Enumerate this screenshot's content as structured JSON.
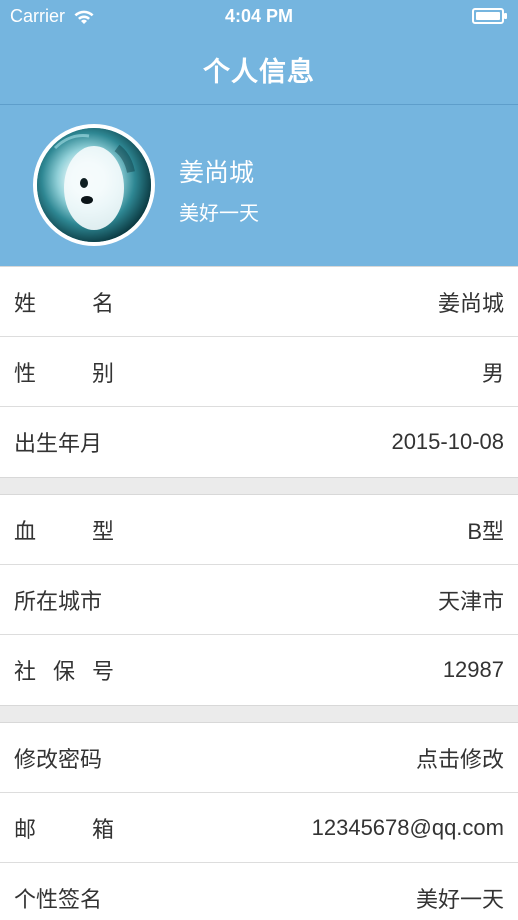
{
  "status_bar": {
    "carrier": "Carrier",
    "time": "4:04 PM"
  },
  "nav": {
    "title": "个人信息"
  },
  "profile": {
    "name": "姜尚城",
    "signature": "美好一天"
  },
  "sections": [
    [
      {
        "label": "姓名",
        "value": "姜尚城"
      },
      {
        "label": "性别",
        "value": "男"
      },
      {
        "label": "出生年月",
        "value": "2015-10-08"
      }
    ],
    [
      {
        "label": "血型",
        "value": "B型"
      },
      {
        "label": "所在城市",
        "value": "天津市"
      },
      {
        "label": "社保号",
        "value": "12987"
      }
    ],
    [
      {
        "label": "修改密码",
        "value": "点击修改"
      },
      {
        "label": "邮箱",
        "value": "12345678@qq.com"
      },
      {
        "label": "个性签名",
        "value": "美好一天"
      }
    ]
  ],
  "colors": {
    "header": "#75b5df",
    "text": "#333333",
    "white": "#ffffff",
    "separator": "#dddddd",
    "gap": "#ebebeb"
  },
  "icons": {
    "status_wifi": "wifi-icon",
    "status_battery": "battery-icon",
    "avatar": "avatar-photo"
  }
}
